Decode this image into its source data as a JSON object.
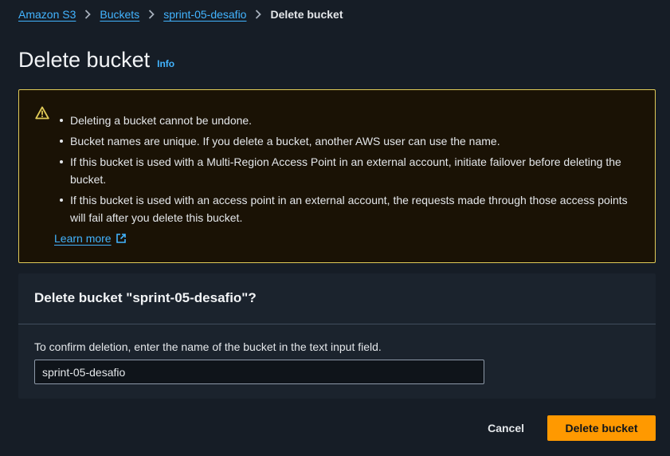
{
  "breadcrumb": {
    "items": [
      {
        "label": "Amazon S3"
      },
      {
        "label": "Buckets"
      },
      {
        "label": "sprint-05-desafio"
      }
    ],
    "current": "Delete bucket"
  },
  "page": {
    "title": "Delete bucket",
    "info_label": "Info"
  },
  "warning": {
    "items": [
      "Deleting a bucket cannot be undone.",
      "Bucket names are unique. If you delete a bucket, another AWS user can use the name.",
      "If this bucket is used with a Multi-Region Access Point in an external account, initiate failover before deleting the bucket.",
      "If this bucket is used with an access point in an external account, the requests made through those access points will fail after you delete this bucket."
    ],
    "learn_more": "Learn more"
  },
  "confirm": {
    "title": "Delete bucket \"sprint-05-desafio\"?",
    "label": "To confirm deletion, enter the name of the bucket in the text input field.",
    "input_value": "sprint-05-desafio"
  },
  "actions": {
    "cancel": "Cancel",
    "delete": "Delete bucket"
  },
  "colors": {
    "accent": "#42b4ff",
    "warning_border": "#e0ca57",
    "primary_button": "#ff9900"
  }
}
